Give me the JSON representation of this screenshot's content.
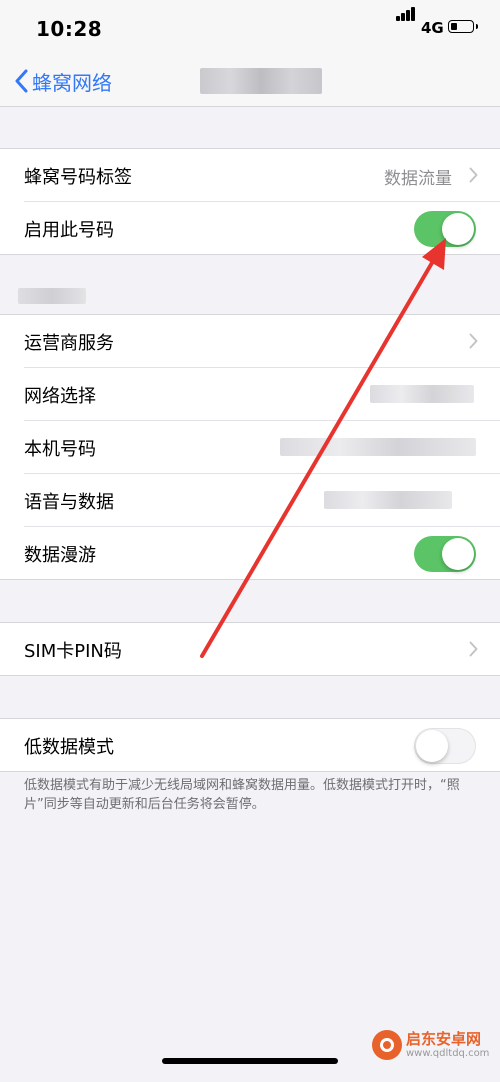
{
  "status_bar": {
    "time": "10:28",
    "network": "4G",
    "battery_level": 0.25
  },
  "nav": {
    "back_label": "蜂窝网络"
  },
  "group1": {
    "rows": [
      {
        "label": "蜂窝号码标签",
        "value": "数据流量"
      },
      {
        "label": "启用此号码",
        "toggle": true
      }
    ]
  },
  "group2": {
    "rows": [
      {
        "label": "运营商服务"
      },
      {
        "label": "网络选择"
      },
      {
        "label": "本机号码"
      },
      {
        "label": "语音与数据"
      },
      {
        "label": "数据漫游",
        "toggle": true
      }
    ]
  },
  "group3": {
    "rows": [
      {
        "label": "SIM卡PIN码"
      }
    ]
  },
  "group4": {
    "rows": [
      {
        "label": "低数据模式",
        "toggle": false
      }
    ],
    "footer": "低数据模式有助于减少无线局域网和蜂窝数据用量。低数据模式打开时，“照片”同步等自动更新和后台任务将会暂停。"
  },
  "watermark": {
    "title": "启东安卓网",
    "url": "www.qdltdq.com"
  },
  "colors": {
    "accent": "#3478f6",
    "switch_on": "#5ac466",
    "arrow": "#e8342e"
  }
}
